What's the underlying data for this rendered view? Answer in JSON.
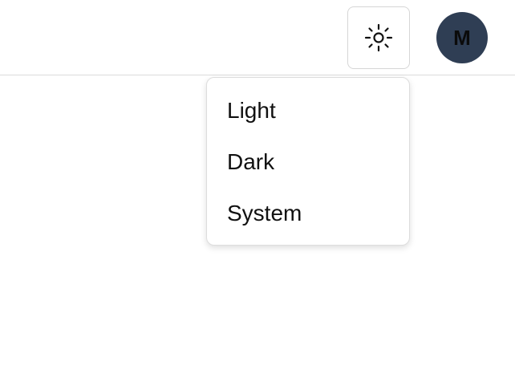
{
  "header": {
    "theme_icon": "sun-icon",
    "avatar_initial": "M"
  },
  "theme_menu": {
    "items": [
      {
        "label": "Light"
      },
      {
        "label": "Dark"
      },
      {
        "label": "System"
      }
    ]
  },
  "colors": {
    "page_background": "#ffffff",
    "header_border": "#dcdcdc",
    "button_border": "#d6d6d6",
    "avatar_background": "#2f3e54",
    "menu_text": "#111111"
  }
}
